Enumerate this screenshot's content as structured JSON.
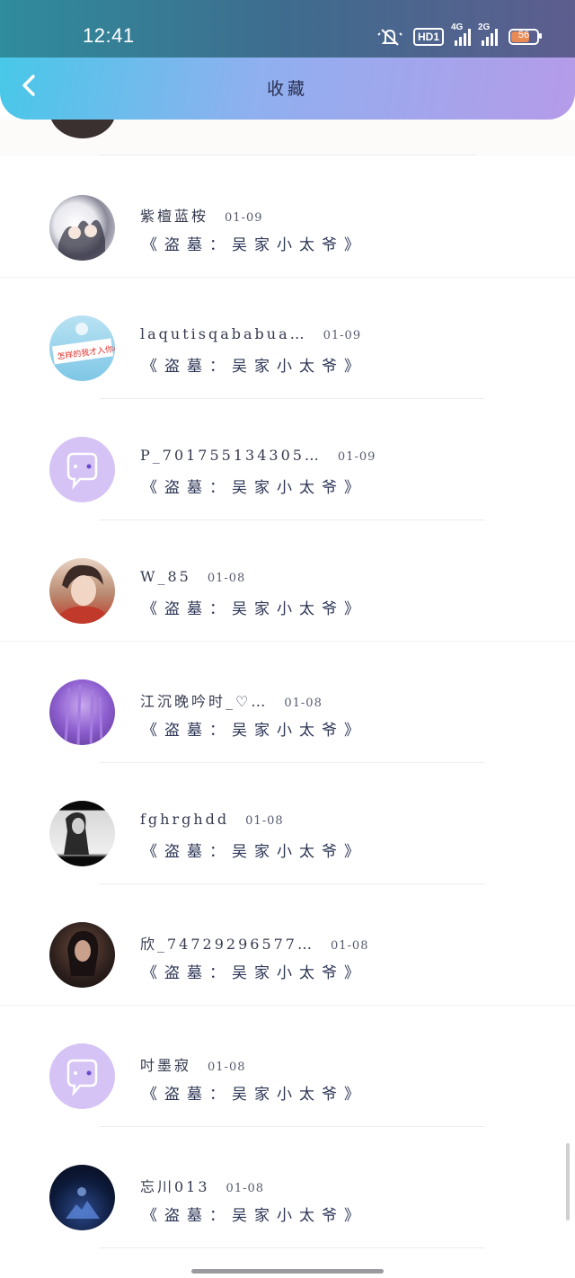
{
  "status_bar": {
    "time": "12:41",
    "hd_label": "HD1",
    "net_1": "4G",
    "net_2": "2G",
    "battery": "56"
  },
  "header": {
    "title": "收藏"
  },
  "items": [
    {
      "name": "紫檀蓝桉",
      "date": "01-09",
      "subtitle": "《盗墓：吴家小太爷》",
      "avatar": "avatar-anime-pair"
    },
    {
      "name": "laqutisqababua…",
      "date": "01-09",
      "subtitle": "《盗墓：吴家小太爷》",
      "avatar": "avatar-cartoon-sign"
    },
    {
      "name": "P_701755134305…",
      "date": "01-09",
      "subtitle": "《盗墓：吴家小太爷》",
      "avatar": "default-chat-avatar"
    },
    {
      "name": "W_85",
      "date": "01-08",
      "subtitle": "《盗墓：吴家小太爷》",
      "avatar": "avatar-anime-boy"
    },
    {
      "name": "江沉晚吟时_♡…",
      "date": "01-08",
      "subtitle": "《盗墓：吴家小太爷》",
      "avatar": "avatar-lavender"
    },
    {
      "name": "fghrghdd",
      "date": "01-08",
      "subtitle": "《盗墓：吴家小太爷》",
      "avatar": "avatar-bw-portrait"
    },
    {
      "name": "欣_74729296577…",
      "date": "01-08",
      "subtitle": "《盗墓：吴家小太爷》",
      "avatar": "avatar-dark-portrait"
    },
    {
      "name": "吋墨寂",
      "date": "01-08",
      "subtitle": "《盗墓：吴家小太爷》",
      "avatar": "default-chat-avatar"
    },
    {
      "name": "忘川013",
      "date": "01-08",
      "subtitle": "《盗墓：吴家小太爷》",
      "avatar": "avatar-night-blue"
    }
  ],
  "colors": {
    "header_start": "#45c9e8",
    "header_end": "#b59be9",
    "default_avatar_bg": "#d6c3f5"
  }
}
